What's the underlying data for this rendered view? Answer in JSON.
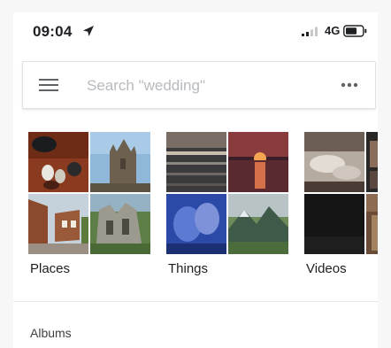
{
  "status_bar": {
    "time": "09:04",
    "network": "4G",
    "icons": [
      "location-arrow-icon",
      "signal-icon",
      "battery-icon"
    ]
  },
  "search": {
    "placeholder": "Search \"wedding\"",
    "menu_icon": "menu-icon",
    "more_icon": "more-horizontal-icon"
  },
  "categories": [
    {
      "label": "Places"
    },
    {
      "label": "Things"
    },
    {
      "label": "Videos"
    }
  ],
  "sections": {
    "albums_title": "Albums"
  }
}
